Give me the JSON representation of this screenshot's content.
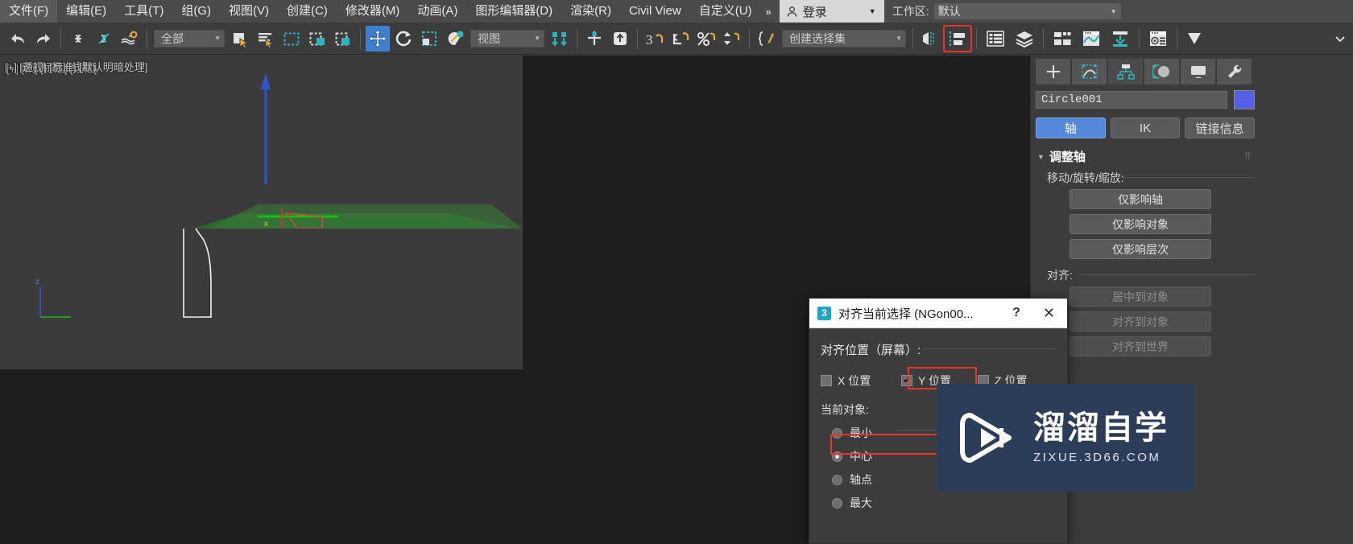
{
  "menubar": {
    "items": [
      {
        "label": "文件(F)"
      },
      {
        "label": "编辑(E)"
      },
      {
        "label": "工具(T)"
      },
      {
        "label": "组(G)"
      },
      {
        "label": "视图(V)"
      },
      {
        "label": "创建(C)"
      },
      {
        "label": "修改器(M)"
      },
      {
        "label": "动画(A)"
      },
      {
        "label": "图形编辑器(D)"
      },
      {
        "label": "渲染(R)"
      },
      {
        "label": "Civil View"
      },
      {
        "label": "自定义(U)"
      }
    ],
    "overflow_chevron": "»",
    "login_label": "登录",
    "login_caret": "▼",
    "workspace_label": "工作区:",
    "workspace_value": "默认",
    "workspace_caret": "▼"
  },
  "toolbar": {
    "select_filter_value": "全部",
    "select_filter_caret": "▼",
    "ref_coord_value": "视图",
    "ref_coord_caret": "▼",
    "named_set_value": "创建选择集",
    "named_set_caret": "▼",
    "icons": [
      "undo-icon",
      "redo-icon",
      "link-icon",
      "unlink-icon",
      "bind-space-warp-icon",
      "select-object-icon",
      "select-by-name-icon",
      "rect-select-region-icon",
      "window-crossing-icon",
      "select-and-move-icon",
      "select-and-rotate-icon",
      "select-and-scale-icon",
      "select-and-place-icon",
      "use-pivot-center-icon",
      "snap-toggle-icon",
      "angle-snap-icon",
      "percent-snap-icon",
      "spinner-snap-icon",
      "edit-named-selection-icon",
      "mirror-icon",
      "align-icon",
      "layer-explorer-icon",
      "layer-manager-icon",
      "ribbon-icon",
      "curve-editor-icon",
      "schematic-view-icon",
      "material-editor-icon",
      "render-setup-icon"
    ]
  },
  "viewports": [
    {
      "id": "top",
      "label": "[+] [顶] [标准] [线框]",
      "selected": true
    },
    {
      "id": "front",
      "label": "[+] [前] [标准] [线框]",
      "selected": false
    },
    {
      "id": "left",
      "label": "[+] [左] [标准] [线框]",
      "selected": false
    },
    {
      "id": "persp",
      "label": "[+] [透视] [标准] [默认明暗处理]",
      "selected": false
    }
  ],
  "command_panel": {
    "tabs": [
      {
        "name": "create-tab",
        "icon": "plus-icon",
        "active": false
      },
      {
        "name": "modify-tab",
        "icon": "modify-curve-icon",
        "active": false
      },
      {
        "name": "hierarchy-tab",
        "icon": "hierarchy-icon",
        "active": true
      },
      {
        "name": "motion-tab",
        "icon": "motion-wheel-icon",
        "active": false
      },
      {
        "name": "display-tab",
        "icon": "display-monitor-icon",
        "active": false
      },
      {
        "name": "utilities-tab",
        "icon": "wrench-icon",
        "active": false
      }
    ],
    "object_name": "Circle001",
    "object_color": "#5560e8",
    "mode_buttons": [
      {
        "label": "轴",
        "active": true
      },
      {
        "label": "IK",
        "active": false
      },
      {
        "label": "链接信息",
        "active": false
      }
    ],
    "rollout_title": "调整轴",
    "group_move": {
      "label": "移动/旋转/缩放:",
      "buttons": [
        {
          "label": "仅影响轴",
          "disabled": false
        },
        {
          "label": "仅影响对象",
          "disabled": false
        },
        {
          "label": "仅影响层次",
          "disabled": false
        }
      ]
    },
    "group_align": {
      "label": "对齐:",
      "buttons": [
        {
          "label": "居中到对象",
          "disabled": true
        },
        {
          "label": "对齐到对象",
          "disabled": true
        },
        {
          "label": "对齐到世界",
          "disabled": true
        }
      ]
    }
  },
  "dialog": {
    "badge": "3",
    "title": "对齐当前选择 (NGon00...",
    "help_glyph": "?",
    "close_glyph": "✕",
    "position_group_label": "对齐位置（屏幕）:",
    "axes": [
      {
        "label": "X 位置",
        "checked": false,
        "highlighted": false
      },
      {
        "label": "Y 位置",
        "checked": true,
        "highlighted": true
      },
      {
        "label": "Z 位置",
        "checked": false,
        "highlighted": false
      }
    ],
    "current_object_label": "当前对象:",
    "current_object_options": [
      {
        "label": "最小",
        "selected": false,
        "highlighted": false
      },
      {
        "label": "中心",
        "selected": true,
        "highlighted": true
      },
      {
        "label": "轴点",
        "selected": false,
        "highlighted": false
      },
      {
        "label": "最大",
        "selected": false,
        "highlighted": false
      }
    ]
  },
  "watermark": {
    "logo_icon": "play-triangle-logo-icon",
    "title": "溜溜自学",
    "subtitle": "ZIXUE.3D66.COM",
    "bg_color": "#2b3d59"
  }
}
